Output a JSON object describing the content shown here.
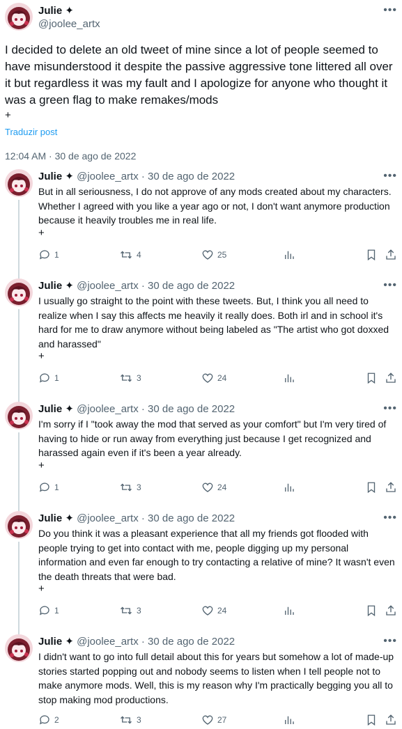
{
  "main": {
    "name": "Julie ✦",
    "handle": "@joolee_artx",
    "text": "I decided to delete an old tweet of mine since a lot of people seemed to have misunderstood it despite the passive aggressive tone littered all over it but regardless it was my fault and I apologize for anyone who thought it was a green flag to make remakes/mods",
    "plus": "+",
    "translate": "Traduzir post",
    "timestamp": "12:04 AM · 30 de ago de 2022"
  },
  "replies": [
    {
      "name": "Julie ✦",
      "meta": "@joolee_artx · 30 de ago de 2022",
      "text": "But in all seriousness, I do not approve of any mods created about my characters. Whether I agreed with you like a year ago or not, I don't want anymore production because it heavily troubles me in real life.",
      "plus": "+",
      "replies": "1",
      "reposts": "4",
      "likes": "25"
    },
    {
      "name": "Julie ✦",
      "meta": "@joolee_artx · 30 de ago de 2022",
      "text": "I usually go straight to the point with these tweets. But, I think you all need to realize when I say this affects me heavily it really does. Both irl and in school it's hard for me to draw anymore without being labeled as \"The artist who got doxxed and harassed\"",
      "plus": "+",
      "replies": "1",
      "reposts": "3",
      "likes": "24"
    },
    {
      "name": "Julie ✦",
      "meta": "@joolee_artx · 30 de ago de 2022",
      "text": "I'm sorry if I \"took away the mod that served as your comfort\" but I'm very tired of having to hide or run away from everything just because I get recognized and harassed again even if it's been a year already.",
      "plus": "+",
      "replies": "1",
      "reposts": "3",
      "likes": "24"
    },
    {
      "name": "Julie ✦",
      "meta": "@joolee_artx · 30 de ago de 2022",
      "text": "Do you think it was a pleasant experience that all my friends got flooded with people trying to get into contact with me, people digging up my personal information and even far enough to try contacting a relative of mine? It wasn't even the death threats that were bad.",
      "plus": "+",
      "replies": "1",
      "reposts": "3",
      "likes": "24"
    },
    {
      "name": "Julie ✦",
      "meta": "@joolee_artx · 30 de ago de 2022",
      "text": "I didn't want to go into full detail about this for years but somehow a lot of made-up stories started popping out and nobody seems to listen when I tell people not to make anymore mods. Well, this is my reason why I'm practically begging you all to stop making mod productions.",
      "plus": "",
      "replies": "2",
      "reposts": "3",
      "likes": "27"
    }
  ],
  "icons": {
    "reply": "reply-icon",
    "repost": "repost-icon",
    "like": "heart-icon",
    "views": "analytics-icon",
    "bookmark": "bookmark-icon",
    "share": "share-icon",
    "more": "more-icon"
  },
  "colors": {
    "text": "#0f1419",
    "secondary": "#536471",
    "link": "#1d9bf0",
    "thread_line": "#cfd9de",
    "avatar_bg": "#f3d7dc",
    "avatar_hair": "#7a1f2e"
  }
}
